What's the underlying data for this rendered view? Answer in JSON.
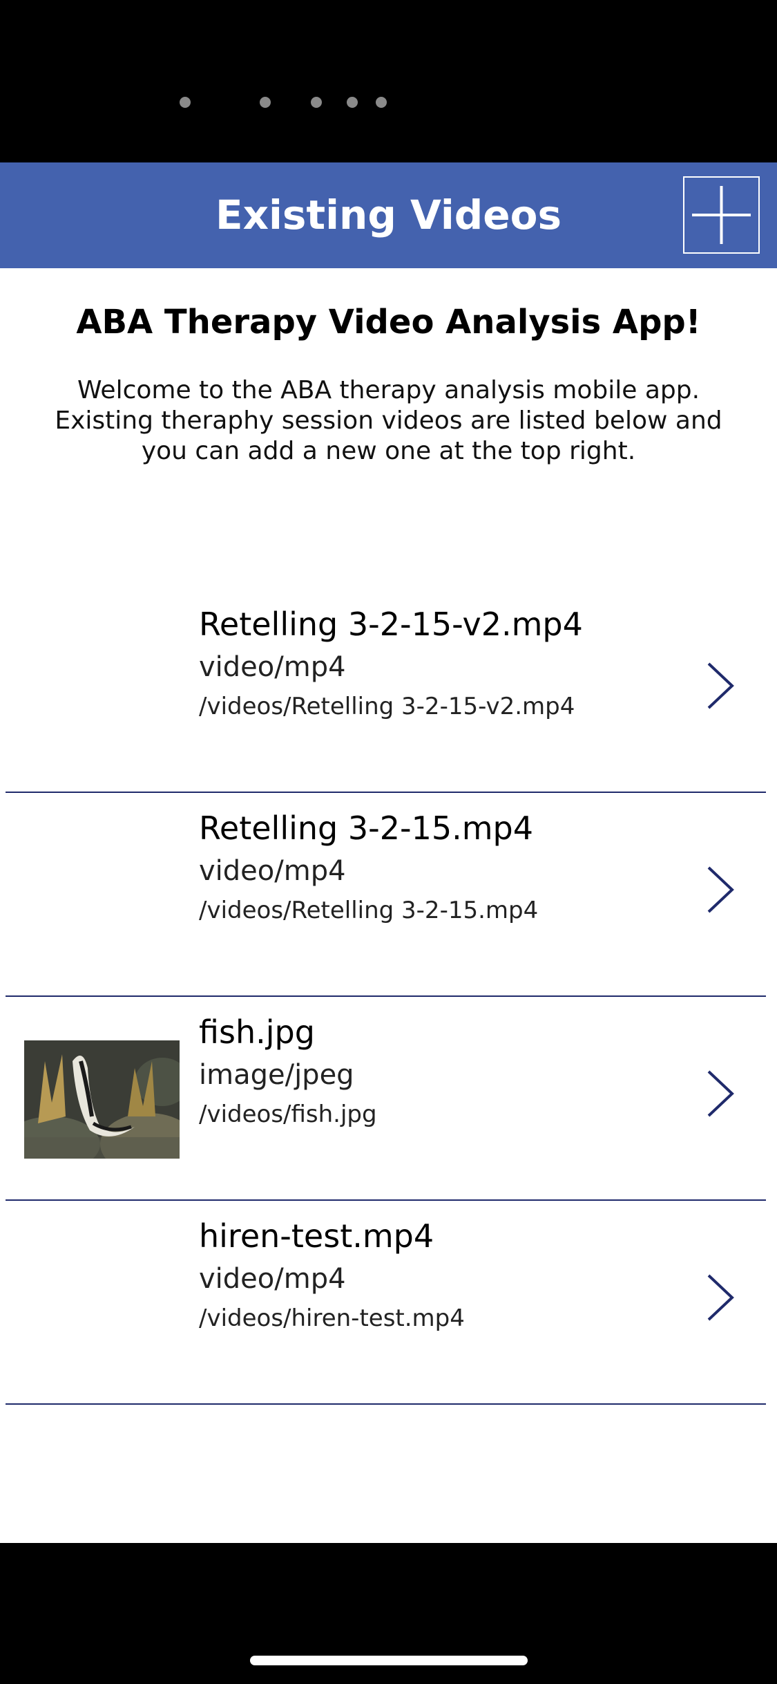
{
  "header": {
    "title": "Existing Videos",
    "add_icon": "plus-icon"
  },
  "intro": {
    "title": "ABA Therapy Video Analysis App!",
    "text": "Welcome to the ABA therapy analysis mobile app. Existing theraphy session videos are listed below and you can add a new one at the top right."
  },
  "items": [
    {
      "name": "Retelling 3-2-15-v2.mp4",
      "type": "video/mp4",
      "path": "/videos/Retelling 3-2-15-v2.mp4",
      "thumbnail": ""
    },
    {
      "name": "Retelling 3-2-15.mp4",
      "type": "video/mp4",
      "path": "/videos/Retelling 3-2-15.mp4",
      "thumbnail": ""
    },
    {
      "name": "fish.jpg",
      "type": "image/jpeg",
      "path": "/videos/fish.jpg",
      "thumbnail": "fish-image"
    },
    {
      "name": "hiren-test.mp4",
      "type": "video/mp4",
      "path": "/videos/hiren-test.mp4",
      "thumbnail": ""
    }
  ],
  "colors": {
    "header_bg": "#4462ae",
    "divider": "#1f2a6b",
    "chevron": "#1f2a6b"
  }
}
